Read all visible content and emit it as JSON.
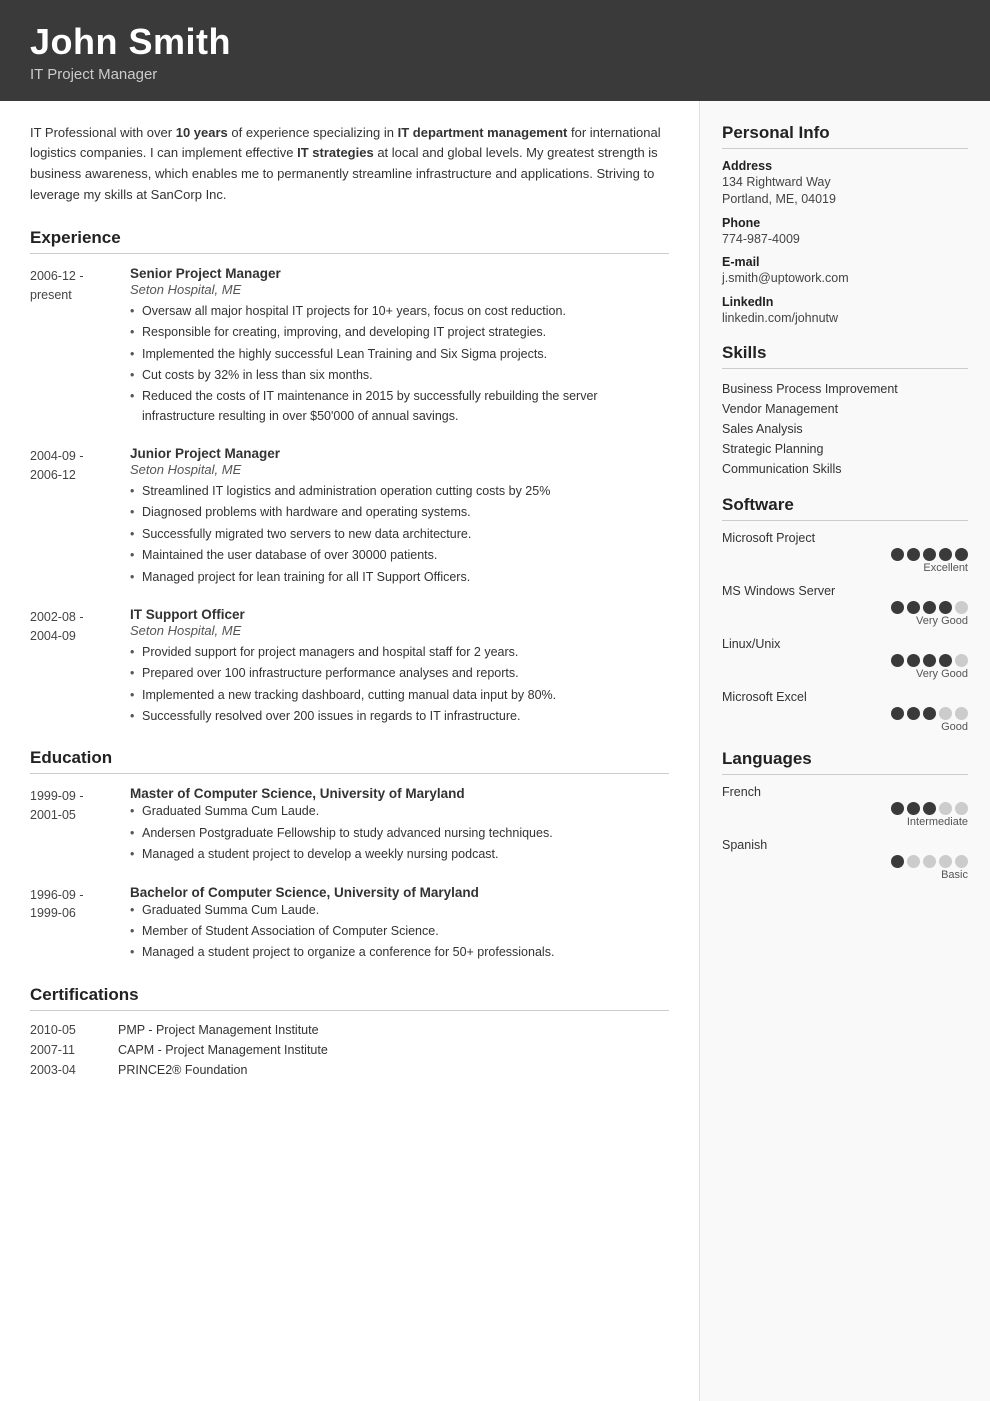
{
  "header": {
    "name": "John Smith",
    "title": "IT Project Manager"
  },
  "summary": "IT Professional with over <strong>10 years</strong> of experience specializing in <strong>IT department management</strong> for international logistics companies. I can implement effective <strong>IT strategies</strong> at local and global levels. My greatest strength is business awareness, which enables me to permanently streamline infrastructure and applications. Striving to leverage my skills at SanCorp Inc.",
  "sections": {
    "experience_label": "Experience",
    "education_label": "Education",
    "certifications_label": "Certifications"
  },
  "experience": [
    {
      "date_start": "2006-12 -",
      "date_end": "present",
      "title": "Senior Project Manager",
      "company": "Seton Hospital, ME",
      "bullets": [
        "Oversaw all major hospital IT projects for 10+ years, focus on cost reduction.",
        "Responsible for creating, improving, and developing IT project strategies.",
        "Implemented the highly successful Lean Training and Six Sigma projects.",
        "Cut costs by 32% in less than six months.",
        "Reduced the costs of IT maintenance in 2015 by successfully rebuilding the server infrastructure resulting in over $50'000 of annual savings."
      ]
    },
    {
      "date_start": "2004-09 -",
      "date_end": "2006-12",
      "title": "Junior Project Manager",
      "company": "Seton Hospital, ME",
      "bullets": [
        "Streamlined IT logistics and administration operation cutting costs by 25%",
        "Diagnosed problems with hardware and operating systems.",
        "Successfully migrated two servers to new data architecture.",
        "Maintained the user database of over 30000 patients.",
        "Managed project for lean training for all IT Support Officers."
      ]
    },
    {
      "date_start": "2002-08 -",
      "date_end": "2004-09",
      "title": "IT Support Officer",
      "company": "Seton Hospital, ME",
      "bullets": [
        "Provided support for project managers and hospital staff for 2 years.",
        "Prepared over 100 infrastructure performance analyses and reports.",
        "Implemented a new tracking dashboard, cutting manual data input by 80%.",
        "Successfully resolved over 200 issues in regards to IT infrastructure."
      ]
    }
  ],
  "education": [
    {
      "date_start": "1999-09 -",
      "date_end": "2001-05",
      "title": "Master of Computer Science, University of Maryland",
      "bullets": [
        "Graduated Summa Cum Laude.",
        "Andersen Postgraduate Fellowship to study advanced nursing techniques.",
        "Managed a student project to develop a weekly nursing podcast."
      ]
    },
    {
      "date_start": "1996-09 -",
      "date_end": "1999-06",
      "title": "Bachelor of Computer Science, University of Maryland",
      "bullets": [
        "Graduated Summa Cum Laude.",
        "Member of Student Association of Computer Science.",
        "Managed a student project to organize a conference for 50+ professionals."
      ]
    }
  ],
  "certifications": [
    {
      "date": "2010-05",
      "name": "PMP - Project Management Institute"
    },
    {
      "date": "2007-11",
      "name": "CAPM - Project Management Institute"
    },
    {
      "date": "2003-04",
      "name": "PRINCE2® Foundation"
    }
  ],
  "personal_info": {
    "label": "Personal Info",
    "address_label": "Address",
    "address_value": "134 Rightward Way\nPortland, ME, 04019",
    "phone_label": "Phone",
    "phone_value": "774-987-4009",
    "email_label": "E-mail",
    "email_value": "j.smith@uptowork.com",
    "linkedin_label": "LinkedIn",
    "linkedin_value": "linkedin.com/johnutw"
  },
  "skills": {
    "label": "Skills",
    "items": [
      "Business Process Improvement",
      "Vendor Management",
      "Sales Analysis",
      "Strategic Planning",
      "Communication Skills"
    ]
  },
  "software": {
    "label": "Software",
    "items": [
      {
        "name": "Microsoft Project",
        "filled": 5,
        "total": 5,
        "level": "Excellent"
      },
      {
        "name": "MS Windows Server",
        "filled": 4,
        "total": 5,
        "level": "Very Good"
      },
      {
        "name": "Linux/Unix",
        "filled": 4,
        "total": 5,
        "level": "Very Good"
      },
      {
        "name": "Microsoft Excel",
        "filled": 3,
        "total": 5,
        "level": "Good"
      }
    ]
  },
  "languages": {
    "label": "Languages",
    "items": [
      {
        "name": "French",
        "filled": 3,
        "total": 5,
        "level": "Intermediate"
      },
      {
        "name": "Spanish",
        "filled": 1,
        "total": 5,
        "level": "Basic"
      }
    ]
  }
}
